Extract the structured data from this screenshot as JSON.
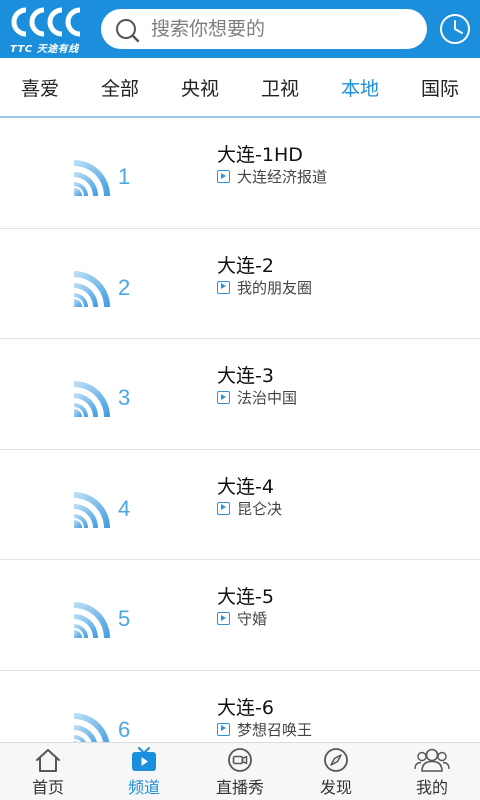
{
  "header": {
    "logo_text": "TTC 天途有线",
    "search_placeholder": "搜索你想要的",
    "brand_color": "#1c8fdc"
  },
  "tabs": [
    {
      "label": "喜爱",
      "active": false
    },
    {
      "label": "全部",
      "active": false
    },
    {
      "label": "央视",
      "active": false
    },
    {
      "label": "卫视",
      "active": false
    },
    {
      "label": "本地",
      "active": true
    },
    {
      "label": "国际",
      "active": false
    }
  ],
  "channels": [
    {
      "number": "1",
      "name": "大连-1HD",
      "program": "大连经济报道"
    },
    {
      "number": "2",
      "name": "大连-2",
      "program": "我的朋友圈"
    },
    {
      "number": "3",
      "name": "大连-3",
      "program": "法治中国"
    },
    {
      "number": "4",
      "name": "大连-4",
      "program": "昆仑决"
    },
    {
      "number": "5",
      "name": "大连-5",
      "program": "守婚"
    },
    {
      "number": "6",
      "name": "大连-6",
      "program": "梦想召唤王"
    }
  ],
  "bottom_nav": [
    {
      "label": "首页",
      "icon": "home-icon",
      "active": false
    },
    {
      "label": "频道",
      "icon": "tv-icon",
      "active": true
    },
    {
      "label": "直播秀",
      "icon": "camera-icon",
      "active": false
    },
    {
      "label": "发现",
      "icon": "compass-icon",
      "active": false
    },
    {
      "label": "我的",
      "icon": "user-icon",
      "active": false
    }
  ]
}
